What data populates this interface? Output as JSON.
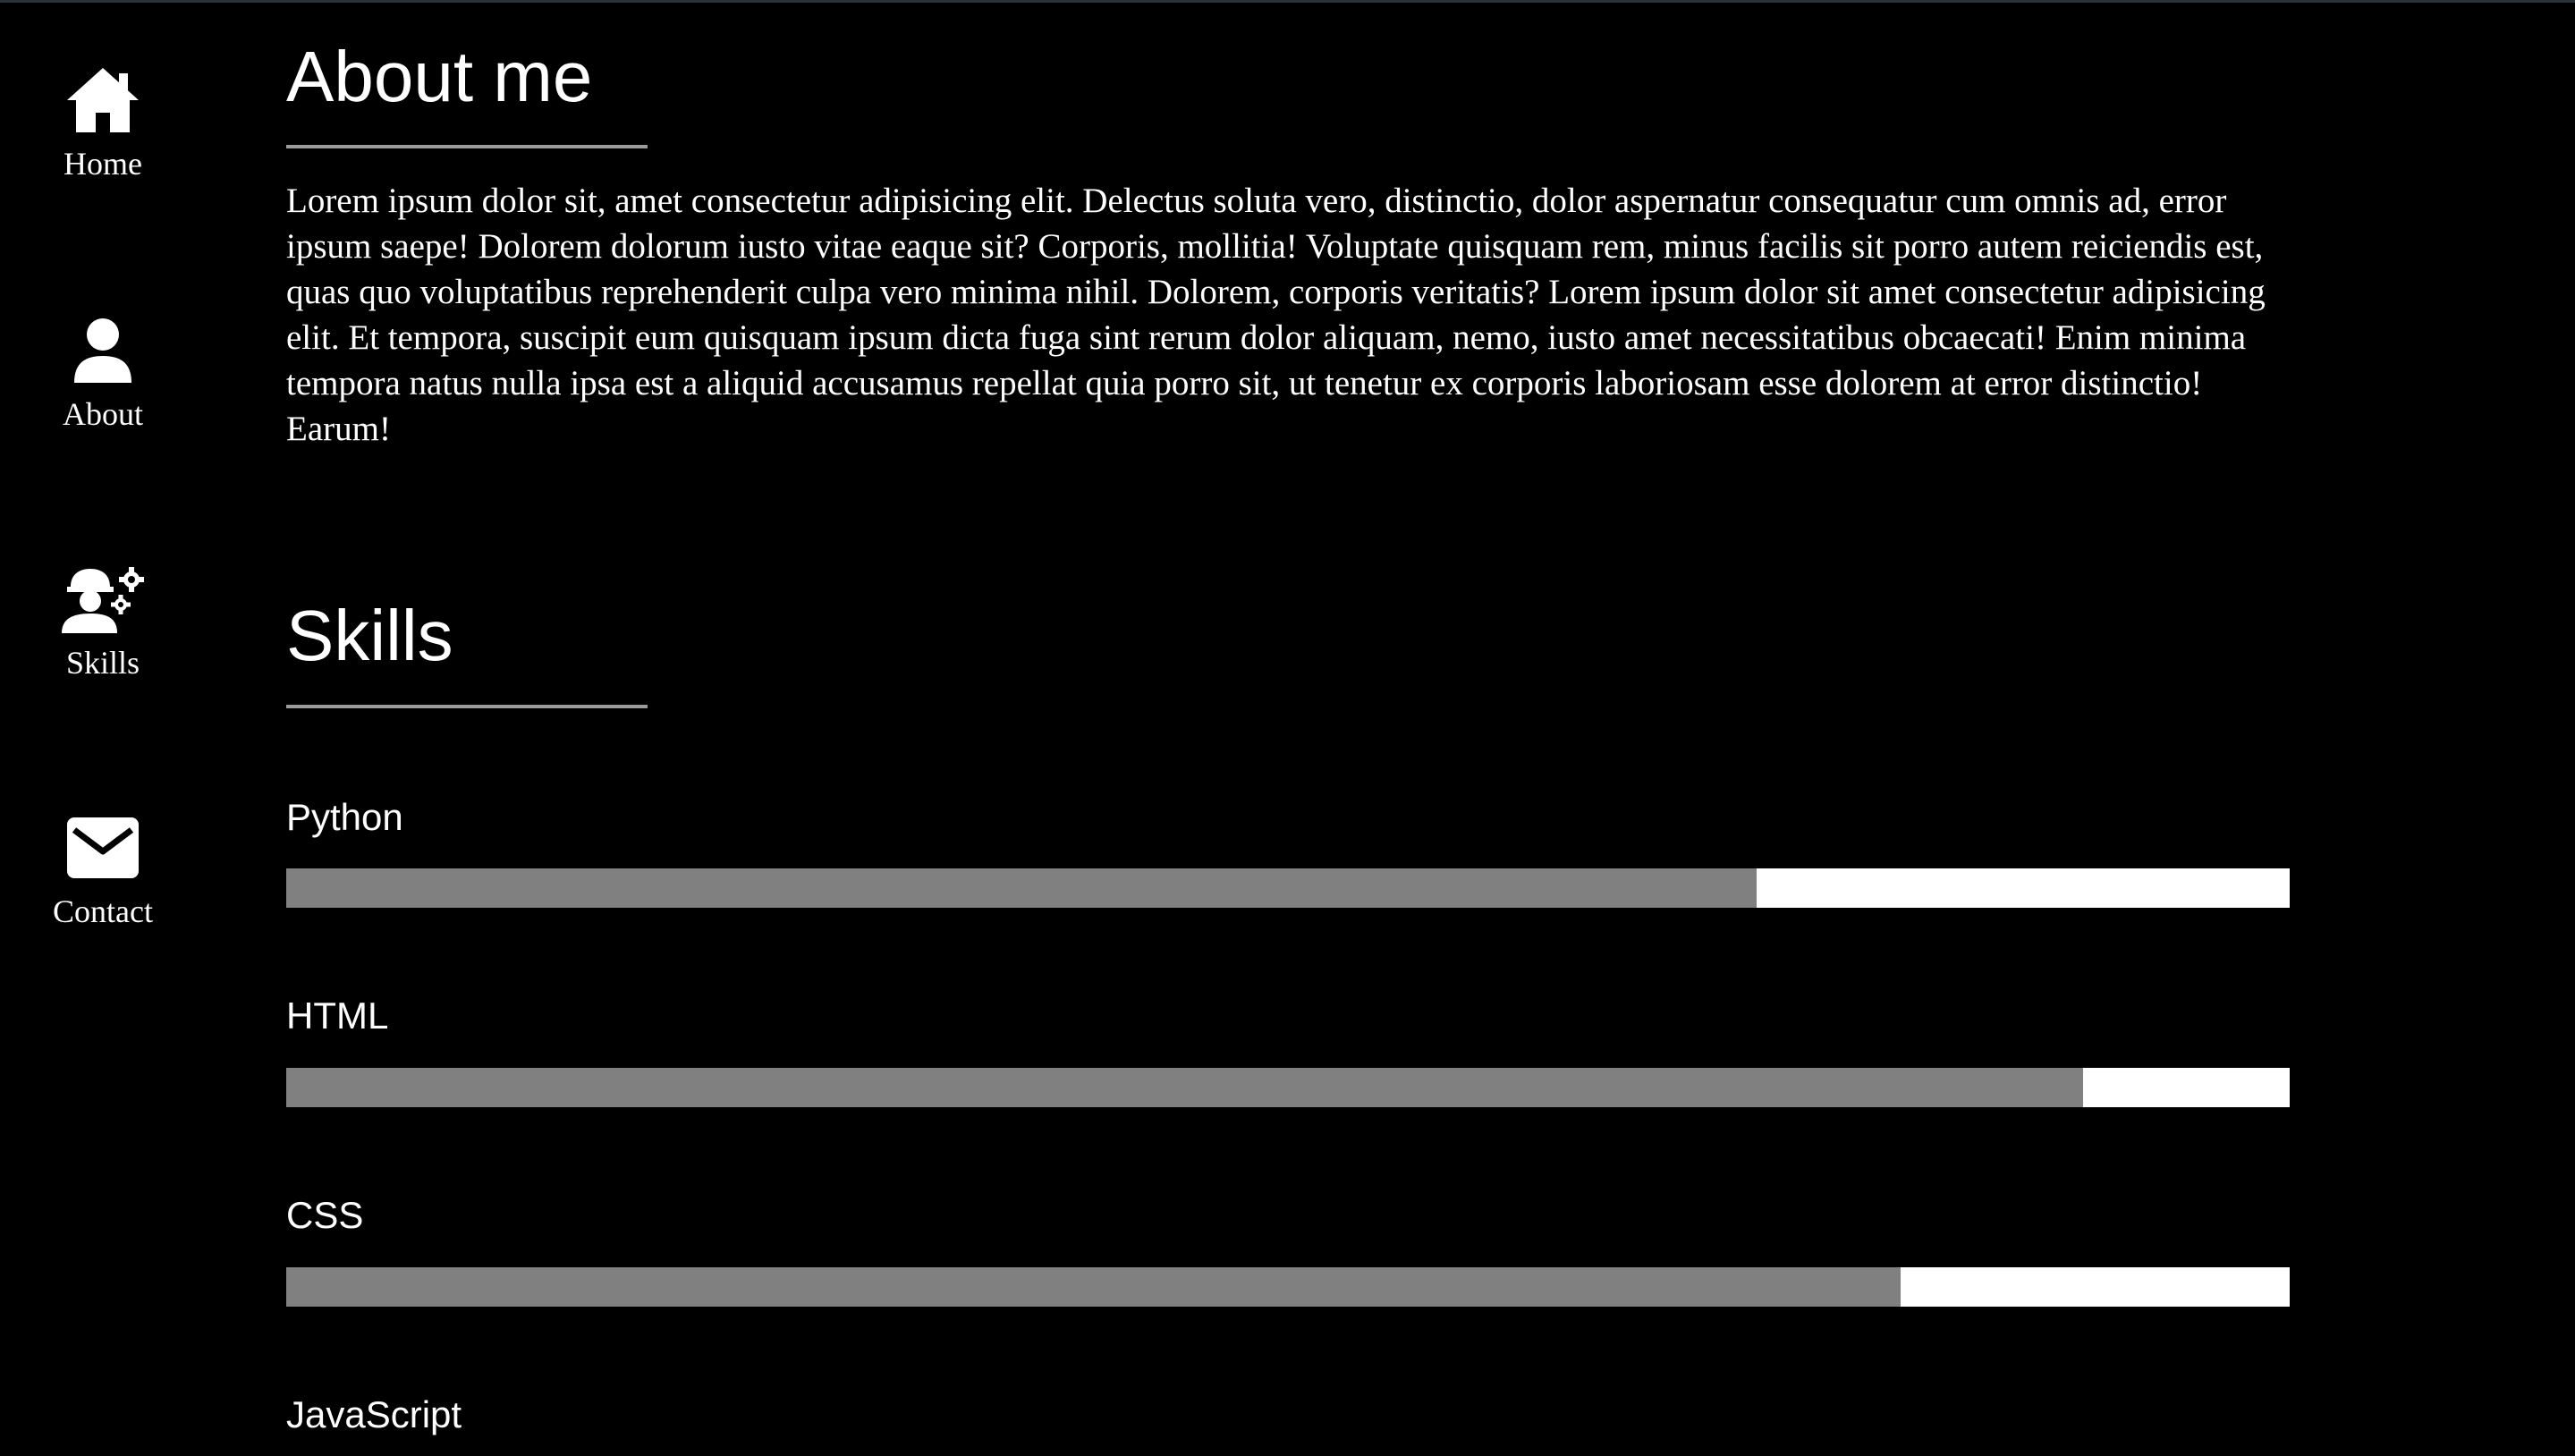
{
  "sidebar": {
    "items": [
      {
        "label": "Home",
        "icon": "home-icon"
      },
      {
        "label": "About",
        "icon": "user-icon"
      },
      {
        "label": "Skills",
        "icon": "worker-gears-icon"
      },
      {
        "label": "Contact",
        "icon": "envelope-icon"
      }
    ]
  },
  "about": {
    "title": "About me",
    "text": "Lorem ipsum dolor sit, amet consectetur adipisicing elit. Delectus soluta vero, distinctio, dolor aspernatur consequatur cum omnis ad, error ipsum saepe! Dolorem dolorum iusto vitae eaque sit? Corporis, mollitia! Voluptate quisquam rem, minus facilis sit porro autem reiciendis est, quas quo voluptatibus reprehenderit culpa vero minima nihil. Dolorem, corporis veritatis? Lorem ipsum dolor sit amet consectetur adipisicing elit. Et tempora, suscipit eum quisquam ipsum dicta fuga sint rerum dolor aliquam, nemo, iusto amet necessitatibus obcaecati! Enim minima tempora natus nulla ipsa est a aliquid accusamus repellat quia porro sit, ut tenetur ex corporis laboriosam esse dolorem at error distinctio! Earum!"
  },
  "skills": {
    "title": "Skills",
    "items": [
      {
        "name": "Python",
        "level": 0.734
      },
      {
        "name": "HTML",
        "level": 0.897
      },
      {
        "name": "CSS",
        "level": 0.806
      },
      {
        "name": "JavaScript"
      }
    ]
  },
  "colors": {
    "background": "#000000",
    "text": "#ffffff",
    "bar_fill": "#808080",
    "bar_track": "#ffffff",
    "underline": "#9a9a9a"
  }
}
